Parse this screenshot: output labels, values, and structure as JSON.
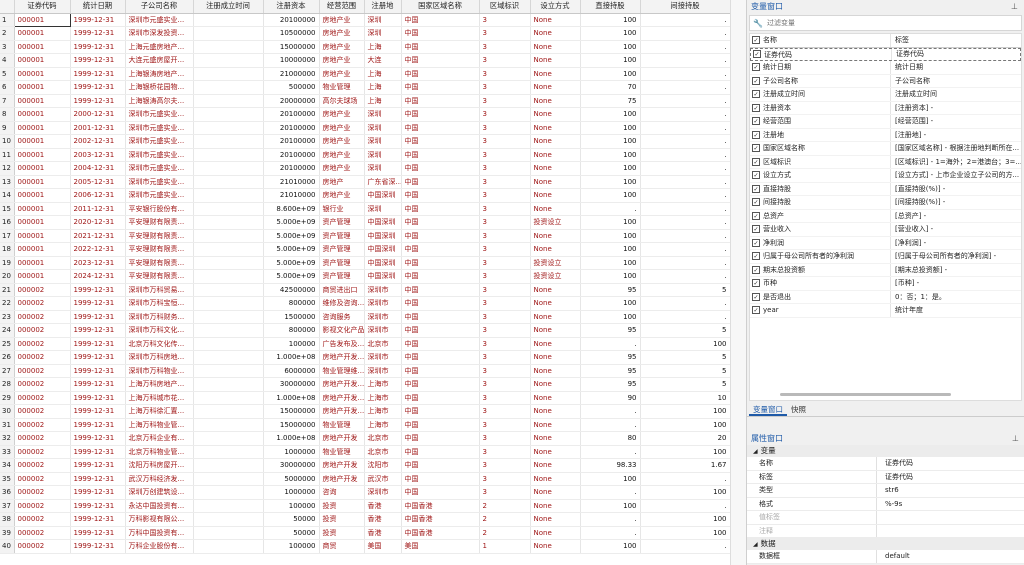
{
  "grid": {
    "columns": [
      "证券代码",
      "统计日期",
      "子公司名称",
      "注册成立时间",
      "注册资本",
      "经营范围",
      "注册地",
      "国家区域名称",
      "区域标识",
      "设立方式",
      "直接持股",
      "间接持股"
    ],
    "rows": [
      [
        "000001",
        "1999-12-31",
        "深圳市元盛实业...",
        "",
        "20100000",
        "房地产业",
        "深圳",
        "中国",
        "3",
        "None",
        "100",
        "."
      ],
      [
        "000001",
        "1999-12-31",
        "深圳市深发投资...",
        "",
        "10500000",
        "房地产业",
        "深圳",
        "中国",
        "3",
        "None",
        "100",
        "."
      ],
      [
        "000001",
        "1999-12-31",
        "上海元盛房地产...",
        "",
        "15000000",
        "房地产业",
        "上海",
        "中国",
        "3",
        "None",
        "100",
        "."
      ],
      [
        "000001",
        "1999-12-31",
        "大连元盛房屋开...",
        "",
        "10000000",
        "房地产业",
        "大连",
        "中国",
        "3",
        "None",
        "100",
        "."
      ],
      [
        "000001",
        "1999-12-31",
        "上海银涛房地产...",
        "",
        "21000000",
        "房地产业",
        "上海",
        "中国",
        "3",
        "None",
        "100",
        "."
      ],
      [
        "000001",
        "1999-12-31",
        "上海银桥花园物...",
        "",
        "500000",
        "物业管理",
        "上海",
        "中国",
        "3",
        "None",
        "70",
        "."
      ],
      [
        "000001",
        "1999-12-31",
        "上海银涛高尔夫...",
        "",
        "20000000",
        "高尔夫球场",
        "上海",
        "中国",
        "3",
        "None",
        "75",
        "."
      ],
      [
        "000001",
        "2000-12-31",
        "深圳市元盛实业...",
        "",
        "20100000",
        "房地产业",
        "深圳",
        "中国",
        "3",
        "None",
        "100",
        "."
      ],
      [
        "000001",
        "2001-12-31",
        "深圳市元盛实业...",
        "",
        "20100000",
        "房地产业",
        "深圳",
        "中国",
        "3",
        "None",
        "100",
        "."
      ],
      [
        "000001",
        "2002-12-31",
        "深圳市元盛实业...",
        "",
        "20100000",
        "房地产业",
        "深圳",
        "中国",
        "3",
        "None",
        "100",
        "."
      ],
      [
        "000001",
        "2003-12-31",
        "深圳市元盛实业...",
        "",
        "20100000",
        "房地产业",
        "深圳",
        "中国",
        "3",
        "None",
        "100",
        "."
      ],
      [
        "000001",
        "2004-12-31",
        "深圳市元盛实业...",
        "",
        "20100000",
        "房地产业",
        "深圳",
        "中国",
        "3",
        "None",
        "100",
        "."
      ],
      [
        "000001",
        "2005-12-31",
        "深圳市元盛实业...",
        "",
        "21010000",
        "房地产",
        "广东省深...",
        "中国",
        "3",
        "None",
        "100",
        "."
      ],
      [
        "000001",
        "2006-12-31",
        "深圳市元盛实业...",
        "",
        "21010000",
        "房地产业",
        "中国深圳",
        "中国",
        "3",
        "None",
        "100",
        "."
      ],
      [
        "000001",
        "2011-12-31",
        "平安银行股份有...",
        "",
        "8.600e+09",
        "银行业",
        "深圳",
        "中国",
        "3",
        "None",
        ".",
        "."
      ],
      [
        "000001",
        "2020-12-31",
        "平安理财有限责...",
        "",
        "5.000e+09",
        "资产管理",
        "中国深圳",
        "中国",
        "3",
        "投资设立",
        "100",
        "."
      ],
      [
        "000001",
        "2021-12-31",
        "平安理财有限责...",
        "",
        "5.000e+09",
        "资产管理",
        "中国深圳",
        "中国",
        "3",
        "None",
        "100",
        "."
      ],
      [
        "000001",
        "2022-12-31",
        "平安理财有限责...",
        "",
        "5.000e+09",
        "资产管理",
        "中国深圳",
        "中国",
        "3",
        "None",
        "100",
        "."
      ],
      [
        "000001",
        "2023-12-31",
        "平安理财有限责...",
        "",
        "5.000e+09",
        "资产管理",
        "中国深圳",
        "中国",
        "3",
        "投资设立",
        "100",
        "."
      ],
      [
        "000001",
        "2024-12-31",
        "平安理财有限责...",
        "",
        "5.000e+09",
        "资产管理",
        "中国深圳",
        "中国",
        "3",
        "投资设立",
        "100",
        "."
      ],
      [
        "000002",
        "1999-12-31",
        "深圳市万科贸易...",
        "",
        "42500000",
        "商贸进出口",
        "深圳市",
        "中国",
        "3",
        "None",
        "95",
        "5"
      ],
      [
        "000002",
        "1999-12-31",
        "深圳市万科宝恒...",
        "",
        "800000",
        "维修及咨询...",
        "深圳市",
        "中国",
        "3",
        "None",
        "100",
        "."
      ],
      [
        "000002",
        "1999-12-31",
        "深圳市万科财务...",
        "",
        "1500000",
        "咨询服务",
        "深圳市",
        "中国",
        "3",
        "None",
        "100",
        "."
      ],
      [
        "000002",
        "1999-12-31",
        "深圳市万科文化...",
        "",
        "800000",
        "影视文化产品",
        "深圳市",
        "中国",
        "3",
        "None",
        "95",
        "5"
      ],
      [
        "000002",
        "1999-12-31",
        "北京万科文化传...",
        "",
        "100000",
        "广告发布及...",
        "北京市",
        "中国",
        "3",
        "None",
        ".",
        "100"
      ],
      [
        "000002",
        "1999-12-31",
        "深圳市万科房地...",
        "",
        "1.000e+08",
        "房地产开发...",
        "深圳市",
        "中国",
        "3",
        "None",
        "95",
        "5"
      ],
      [
        "000002",
        "1999-12-31",
        "深圳市万科物业...",
        "",
        "6000000",
        "物业管理维...",
        "深圳市",
        "中国",
        "3",
        "None",
        "95",
        "5"
      ],
      [
        "000002",
        "1999-12-31",
        "上海万科房地产...",
        "",
        "30000000",
        "房地产开发...",
        "上海市",
        "中国",
        "3",
        "None",
        "95",
        "5"
      ],
      [
        "000002",
        "1999-12-31",
        "上海万科城市花...",
        "",
        "1.000e+08",
        "房地产开发...",
        "上海市",
        "中国",
        "3",
        "None",
        "90",
        "10"
      ],
      [
        "000002",
        "1999-12-31",
        "上海万科徐汇置...",
        "",
        "15000000",
        "房地产开发...",
        "上海市",
        "中国",
        "3",
        "None",
        ".",
        "100"
      ],
      [
        "000002",
        "1999-12-31",
        "上海万科物业管...",
        "",
        "15000000",
        "物业管理",
        "上海市",
        "中国",
        "3",
        "None",
        ".",
        "100"
      ],
      [
        "000002",
        "1999-12-31",
        "北京万科企业有...",
        "",
        "1.000e+08",
        "房地产开发",
        "北京市",
        "中国",
        "3",
        "None",
        "80",
        "20"
      ],
      [
        "000002",
        "1999-12-31",
        "北京万科物业管...",
        "",
        "1000000",
        "物业管理",
        "北京市",
        "中国",
        "3",
        "None",
        ".",
        "100"
      ],
      [
        "000002",
        "1999-12-31",
        "沈阳万科房屋开...",
        "",
        "30000000",
        "房地产开发",
        "沈阳市",
        "中国",
        "3",
        "None",
        "98.33",
        "1.67"
      ],
      [
        "000002",
        "1999-12-31",
        "武汉万科经济发...",
        "",
        "5000000",
        "房地产开发",
        "武汉市",
        "中国",
        "3",
        "None",
        "100",
        "."
      ],
      [
        "000002",
        "1999-12-31",
        "深圳万创建筑设...",
        "",
        "1000000",
        "咨询",
        "深圳市",
        "中国",
        "3",
        "None",
        ".",
        "100"
      ],
      [
        "000002",
        "1999-12-31",
        "永达中国投资有...",
        "",
        "100000",
        "投资",
        "香港",
        "中国香港",
        "2",
        "None",
        "100",
        "."
      ],
      [
        "000002",
        "1999-12-31",
        "万科影视有限公...",
        "",
        "50000",
        "投资",
        "香港",
        "中国香港",
        "2",
        "None",
        ".",
        "100"
      ],
      [
        "000002",
        "1999-12-31",
        "万科中国投资有...",
        "",
        "50000",
        "投资",
        "香港",
        "中国香港",
        "2",
        "None",
        ".",
        "100"
      ],
      [
        "000002",
        "1999-12-31",
        "万科企业股份有...",
        "",
        "100000",
        "商贸",
        "美国",
        "美国",
        "1",
        "None",
        "100",
        "."
      ]
    ]
  },
  "variable_panel": {
    "title": "变量窗口",
    "filter_placeholder": "过滤变量",
    "col_name": "名称",
    "col_label": "标签",
    "rows": [
      [
        "证券代码",
        "证券代码"
      ],
      [
        "统计日期",
        "统计日期"
      ],
      [
        "子公司名称",
        "子公司名称"
      ],
      [
        "注册成立时间",
        "注册成立时间"
      ],
      [
        "注册资本",
        "[注册资本] -"
      ],
      [
        "经营范围",
        "[经营范围] -"
      ],
      [
        "注册地",
        "[注册地] -"
      ],
      [
        "国家区域名称",
        "[国家区域名称] - 根据注册地判断所在..."
      ],
      [
        "区域标识",
        "[区域标识] - 1=海外；2=港澳台；3=..."
      ],
      [
        "设立方式",
        "[设立方式] - 上市企业设立子公司的方..."
      ],
      [
        "直接持股",
        "[直接持股(%)] -"
      ],
      [
        "间接持股",
        "[间接持股(%)] -"
      ],
      [
        "总资产",
        "[总资产] -"
      ],
      [
        "营业收入",
        "[营业收入] -"
      ],
      [
        "净利润",
        "[净利润] -"
      ],
      [
        "归属于母公司所有者的净利润",
        "[归属于母公司所有者的净利润] -"
      ],
      [
        "期末总投资额",
        "[期末总投资额] -"
      ],
      [
        "币种",
        "[币种] -"
      ],
      [
        "是否退出",
        "0：否；1：是。"
      ],
      [
        "year",
        "统计年度"
      ]
    ],
    "tabs": [
      "变量窗口",
      "快照"
    ]
  },
  "property_panel": {
    "title": "属性窗口",
    "section_var": "变量",
    "section_data": "数据",
    "rows": [
      [
        "名称",
        "证券代码"
      ],
      [
        "标签",
        "证券代码"
      ],
      [
        "类型",
        "str6"
      ],
      [
        "格式",
        "%-9s"
      ],
      [
        "值标签",
        ""
      ],
      [
        "注释",
        ""
      ]
    ],
    "partial_row": [
      "数据框",
      "default"
    ]
  }
}
